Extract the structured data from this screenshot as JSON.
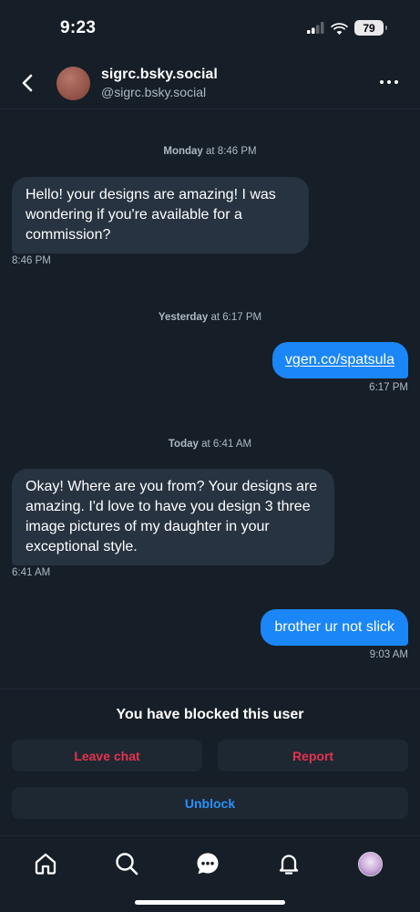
{
  "status_bar": {
    "time": "9:23",
    "battery": "79"
  },
  "header": {
    "display_name": "sigrc.bsky.social",
    "handle": "@sigrc.bsky.social"
  },
  "conversation": [
    {
      "date_day": "Monday",
      "date_time": " at 8:46 PM"
    },
    {
      "sender": "them",
      "text": "Hello! your designs are amazing! I was wondering if you're available for a commission?",
      "time": "8:46 PM"
    },
    {
      "date_day": "Yesterday",
      "date_time": " at 6:17 PM"
    },
    {
      "sender": "me",
      "text": "vgen.co/spatsula",
      "time": "6:17 PM"
    },
    {
      "date_day": "Today",
      "date_time": " at 6:41 AM"
    },
    {
      "sender": "them",
      "text": "Okay! Where are you from? Your designs are amazing. I'd love to have you design 3 three image  pictures of my daughter in your exceptional style.",
      "time": "6:41 AM"
    },
    {
      "sender": "me",
      "text": "brother ur not slick",
      "time": "9:03 AM"
    }
  ],
  "blocked": {
    "message": "You have blocked this user",
    "leave_label": "Leave chat",
    "report_label": "Report",
    "unblock_label": "Unblock"
  },
  "tab_bar": {
    "icons": [
      "home-icon",
      "search-icon",
      "chat-icon",
      "bell-icon",
      "profile-avatar"
    ],
    "active": "chat-icon"
  },
  "colors": {
    "background": "#161e27",
    "their_bubble": "#273340",
    "my_bubble": "#1b86f8",
    "danger": "#e4334d",
    "primary": "#2a91f9"
  }
}
